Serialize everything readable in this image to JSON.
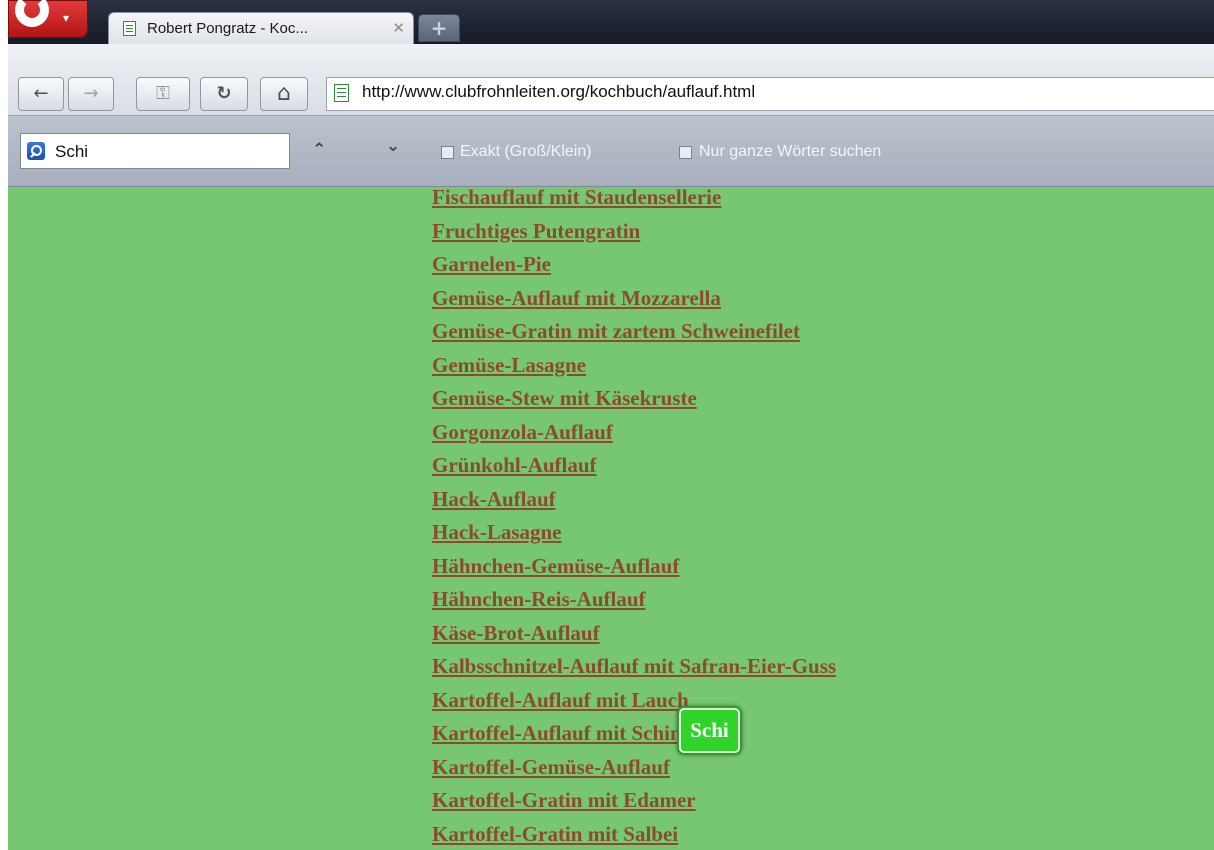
{
  "tab": {
    "title": "Robert Pongratz - Koc...",
    "close": "✕"
  },
  "new_tab": {
    "label": "+"
  },
  "nav": {
    "back": "←",
    "forward": "→",
    "wand": "⚿",
    "reload": "↻",
    "home": "⌂"
  },
  "address": {
    "url": "http://www.clubfrohnleiten.org/kochbuch/auflauf.html"
  },
  "find": {
    "query": "Schi",
    "prev": "⌃",
    "next": "⌄",
    "opt_exact": "Exakt (Groß/Klein)",
    "opt_whole": "Nur ganze Wörter suchen"
  },
  "recipes": [
    "Fischauflauf mit Staudensellerie",
    "Fruchtiges Putengratin",
    "Garnelen-Pie",
    "Gemüse-Auflauf mit Mozzarella",
    "Gemüse-Gratin mit zartem Schweinefilet",
    "Gemüse-Lasagne",
    "Gemüse-Stew mit Käsekruste",
    "Gorgonzola-Auflauf",
    "Grünkohl-Auflauf",
    "Hack-Auflauf",
    "Hack-Lasagne",
    "Hähnchen-Gemüse-Auflauf",
    "Hähnchen-Reis-Auflauf",
    "Käse-Brot-Auflauf",
    "Kalbsschnitzel-Auflauf mit Safran-Eier-Guss",
    "Kartoffel-Auflauf mit Lauch",
    "Kartoffel-Auflauf mit Schinken",
    "Kartoffel-Gemüse-Auflauf",
    "Kartoffel-Gratin mit Edamer",
    "Kartoffel-Gratin mit Salbei"
  ],
  "find_hit": {
    "text": "Schi"
  },
  "colors": {
    "page_bg": "#76c770",
    "link": "#8c4a2e",
    "hit_bg": "#2fd32a"
  }
}
